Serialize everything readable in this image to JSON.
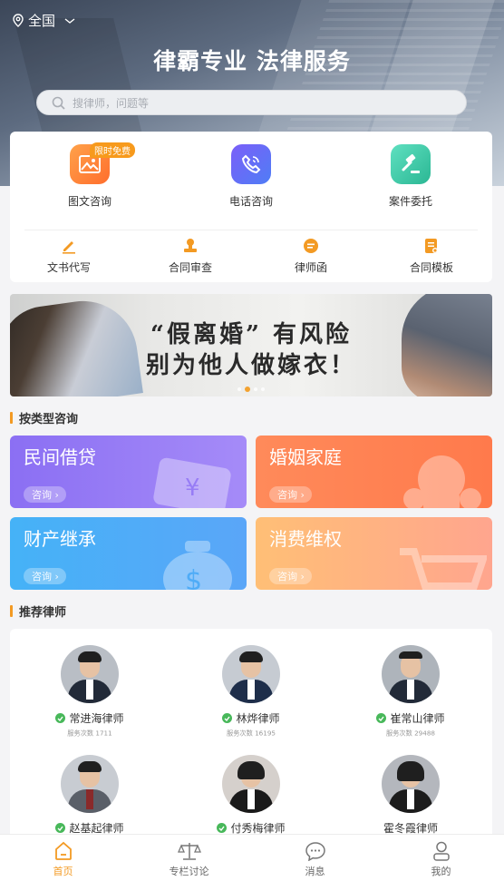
{
  "header": {
    "location": "全国",
    "slogan": "律霸专业 法律服务",
    "search_placeholder": "搜律师，问题等"
  },
  "services": [
    {
      "label": "图文咨询",
      "icon": "image-chat-icon",
      "badge": "限时免费",
      "color": "#ff8a3d"
    },
    {
      "label": "电话咨询",
      "icon": "phone-icon",
      "color": "#6b6ff7"
    },
    {
      "label": "案件委托",
      "icon": "gavel-icon",
      "color": "#3fcaa8"
    }
  ],
  "quick_tools": [
    {
      "label": "文书代写",
      "icon": "pen-icon"
    },
    {
      "label": "合同审查",
      "icon": "stamp-icon"
    },
    {
      "label": "律师函",
      "icon": "letter-icon"
    },
    {
      "label": "合同模板",
      "icon": "document-icon"
    }
  ],
  "banner": {
    "line1": "“假离婚” 有风险",
    "line2": "别为他人做嫁衣！",
    "slide_count": 3,
    "active_slide": 2
  },
  "category_section": {
    "title": "按类型咨询",
    "items": [
      {
        "name": "民间借贷",
        "button": "咨询 ›",
        "icon": "money-card-icon"
      },
      {
        "name": "婚姻家庭",
        "button": "咨询 ›",
        "icon": "family-icon"
      },
      {
        "name": "财产继承",
        "button": "咨询 ›",
        "icon": "money-bag-icon"
      },
      {
        "name": "消费维权",
        "button": "咨询 ›",
        "icon": "cart-icon"
      }
    ]
  },
  "lawyer_section": {
    "title": "推荐律师",
    "lawyers": [
      {
        "name": "常进海律师",
        "stats": "服务次数 1711",
        "verified": true
      },
      {
        "name": "林烨律师",
        "stats": "服务次数 16195",
        "verified": true
      },
      {
        "name": "崔常山律师",
        "stats": "服务次数 29488",
        "verified": true
      },
      {
        "name": "赵基起律师",
        "verified": true
      },
      {
        "name": "付秀梅律师",
        "verified": true
      },
      {
        "name": "霍冬霞律师",
        "verified": false
      }
    ]
  },
  "tabbar": [
    {
      "label": "首页",
      "icon": "home-icon",
      "active": true
    },
    {
      "label": "专栏讨论",
      "icon": "scales-icon",
      "active": false
    },
    {
      "label": "消息",
      "icon": "message-icon",
      "active": false
    },
    {
      "label": "我的",
      "icon": "profile-icon",
      "active": false
    }
  ],
  "colors": {
    "accent": "#f39a23",
    "verified": "#48b85a"
  }
}
